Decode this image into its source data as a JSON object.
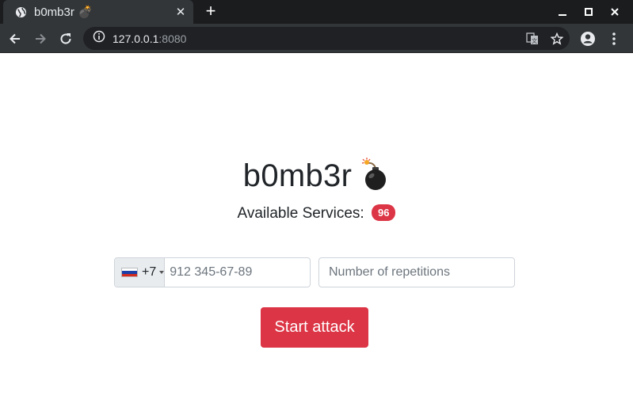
{
  "browser": {
    "tab_title": "b0mb3r 💣",
    "new_tab_label": "+",
    "url_host": "127.0.0.1",
    "url_port": ":8080"
  },
  "page": {
    "title": "b0mb3r",
    "services_label": "Available Services:",
    "services_count": "96",
    "phone": {
      "country_code": "+7",
      "placeholder": "912 345-67-89",
      "flag": "russia-flag-icon"
    },
    "repetitions": {
      "placeholder": "Number of repetitions"
    },
    "start_button_label": "Start attack"
  },
  "colors": {
    "accent": "#dc3545",
    "chrome_bg": "#323639",
    "tabstrip_bg": "#1b1c1e"
  }
}
